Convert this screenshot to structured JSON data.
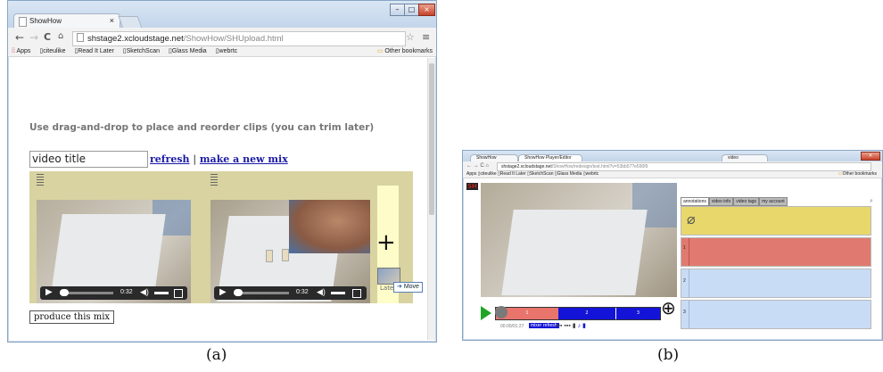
{
  "captions": {
    "a": "(a)",
    "b": "(b)"
  },
  "a": {
    "tab_title": "ShowHow",
    "tab_close": "×",
    "url_host": "shstage2.xcloudstage.net",
    "url_path": "/ShowHow/SHUpload.html",
    "bookmarks": [
      "Apps",
      "citeulike",
      "Read It Later",
      "SketchScan",
      "Glass Media",
      "webrtc"
    ],
    "other_bookmarks": "Other bookmarks",
    "instruction": "Use drag-and-drop to place and reorder clips (you can trim later)",
    "title_input_value": "video title",
    "refresh_link": "refresh",
    "separator": "|",
    "new_mix_link": "make a new mix",
    "clip1_time": "0:32",
    "clip2_time": "0:32",
    "plus": "+",
    "drop_label": "Late",
    "move_tooltip": "Move",
    "produce_button": "produce this mix"
  },
  "b": {
    "tab1": "ShowHow",
    "tab2": "ShowHow Player/Editor",
    "tab3": "video",
    "url_host": "shstage2.xcloudstage.net",
    "url_path": "/ShowHow/redesign/test.html?v=53bb57?e590f9",
    "bookmarks": [
      "Apps",
      "citeulike",
      "Read It Later",
      "SketchScan",
      "Glass Media",
      "webrtc"
    ],
    "other_bookmarks": "Other bookmarks",
    "logo": "SH",
    "tabs": [
      "annotations",
      "video info",
      "video tags",
      "my account"
    ],
    "segments": [
      "1",
      "2",
      "3"
    ],
    "time": "00:00/01:27",
    "mini_buttons": [
      "mixer",
      "refresh"
    ],
    "card_numbers": [
      "1",
      "2",
      "3"
    ],
    "plus": "⊕"
  },
  "colors": {
    "clip_area": "#d8d3a0",
    "drop_zone": "#fefcc8",
    "card_yellow": "#e8d86c",
    "card_red": "#e07a70",
    "card_blue": "#c9dcf5",
    "timeline_red": "#e8746c",
    "timeline_blue": "#1414d8",
    "play_green": "#1ea526"
  }
}
